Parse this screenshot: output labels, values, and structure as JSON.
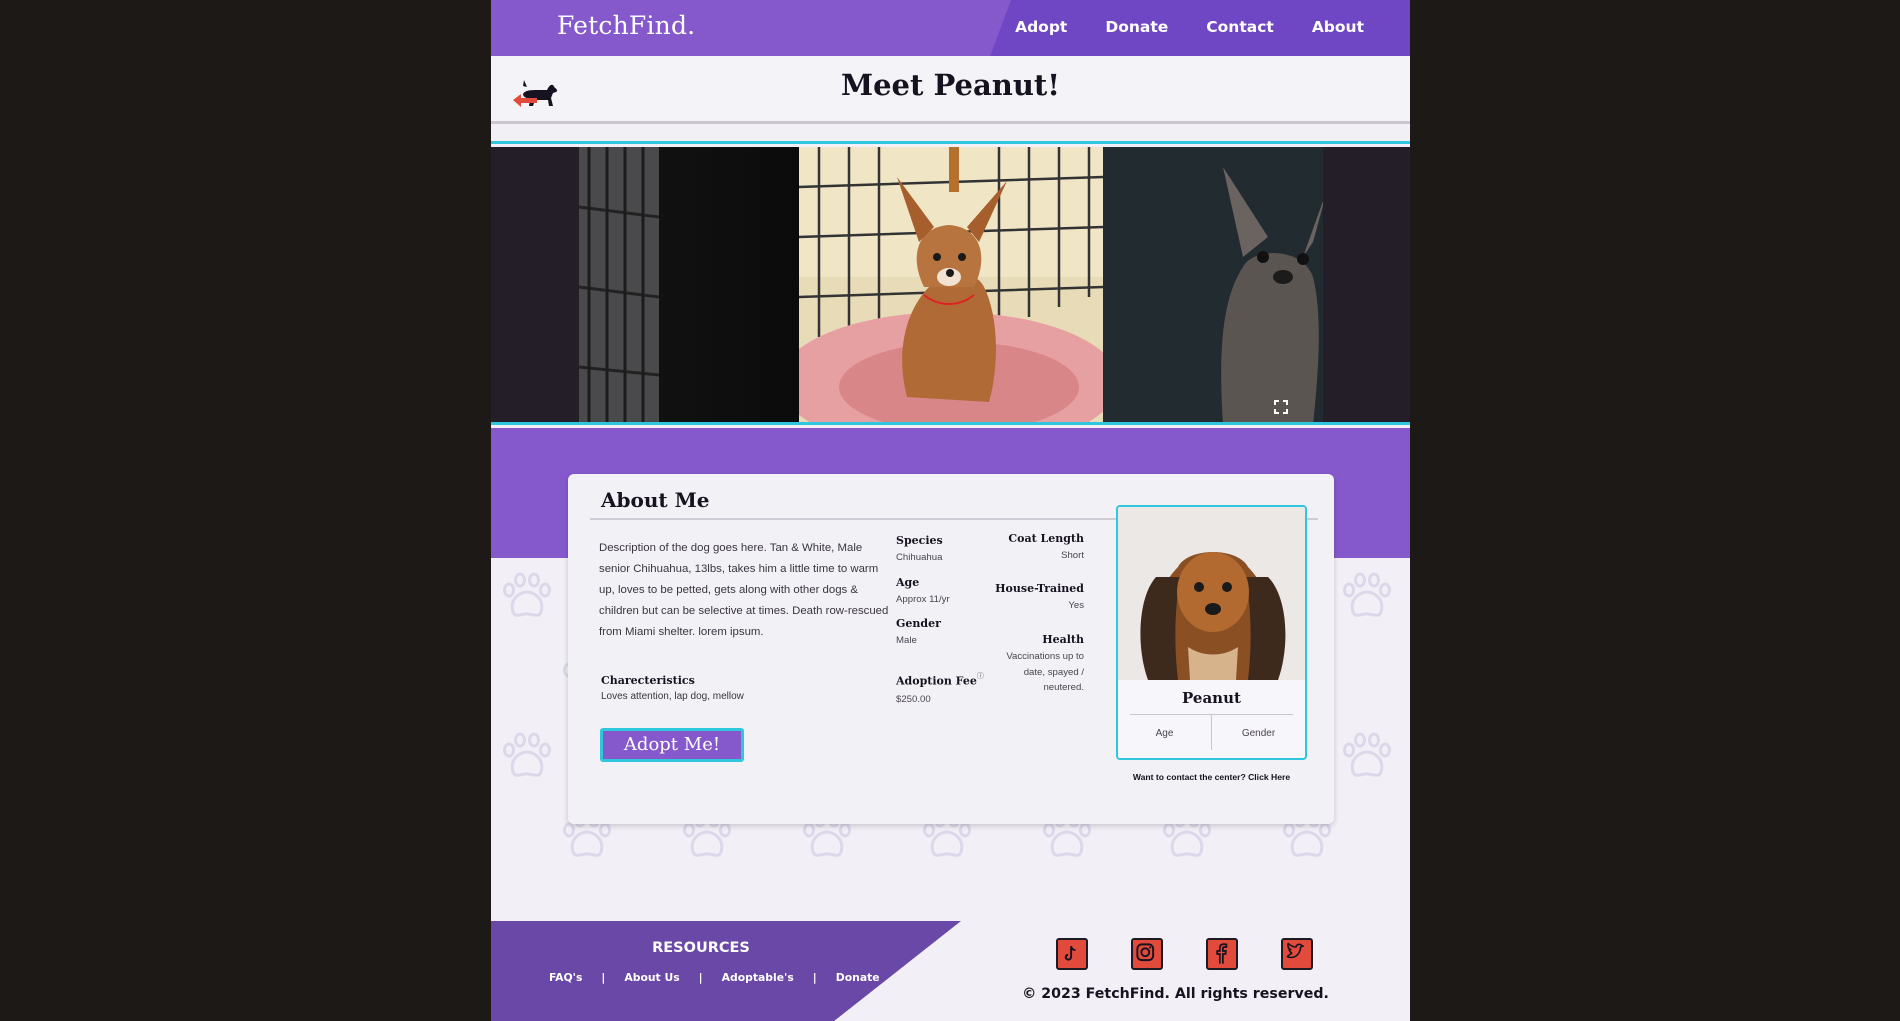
{
  "nav": {
    "logo": "FetchFind.",
    "links": [
      "Adopt",
      "Donate",
      "Contact",
      "About"
    ]
  },
  "header": {
    "title": "Meet Peanut!"
  },
  "about": {
    "title": "About Me",
    "description": "Description of the dog goes here. Tan & White, Male senior Chihuahua, 13lbs, takes him a little time to warm up, loves to be petted, gets along with other dogs & children but can be selective at times. Death row-rescued from Miami shelter. lorem ipsum.",
    "characteristics_label": "Charecteristics",
    "characteristics_value": "Loves attention, lap dog, mellow",
    "adopt_button": "Adopt Me!",
    "fields": {
      "species_label": "Species",
      "species_value": "Chihuahua",
      "age_label": "Age",
      "age_value": "Approx 11/yr",
      "gender_label": "Gender",
      "gender_value": "Male",
      "fee_label": "Adoption Fee",
      "fee_value": "$250.00",
      "coat_label": "Coat Length",
      "coat_value": "Short",
      "house_label": "House-Trained",
      "house_value": "Yes",
      "health_label": "Health",
      "health_value": "Vaccinations up to date, spayed / neutered."
    }
  },
  "profile": {
    "name": "Peanut",
    "age_label": "Age",
    "gender_label": "Gender",
    "contact_note": "Want to contact the center? Click Here"
  },
  "footer": {
    "resources_title": "RESOURCES",
    "links": [
      "FAQ's",
      "About Us",
      "Adoptable's",
      "Donate"
    ],
    "separator": "|",
    "copyright": "© 2023 FetchFind. All rights reserved."
  },
  "colors": {
    "primary_purple": "#8559cc",
    "dark_purple": "#6f46c4",
    "accent_cyan": "#2fc7dd",
    "social_red": "#e24b3c"
  },
  "icons": {
    "back": "dog-back-arrow-icon",
    "expand": "expand-icon",
    "socials": [
      "tiktok-icon",
      "instagram-icon",
      "facebook-icon",
      "twitter-icon"
    ]
  }
}
